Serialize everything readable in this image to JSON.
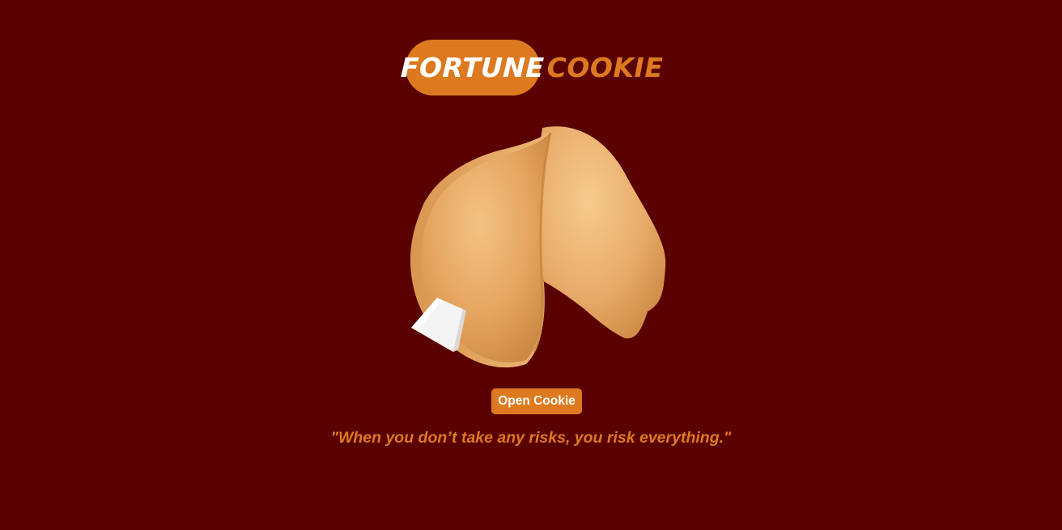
{
  "header": {
    "title_word1": "FORTUNE",
    "title_word2": "COOKIE"
  },
  "image": {
    "subject": "fortune-cookie-image"
  },
  "actions": {
    "open_button_label": "Open Cookie"
  },
  "fortune": {
    "text": "\"When you don’t take any risks, you risk everything.\""
  },
  "colors": {
    "background": "#5a0000",
    "accent": "#dd7a1f",
    "button_text": "#ffffff"
  }
}
